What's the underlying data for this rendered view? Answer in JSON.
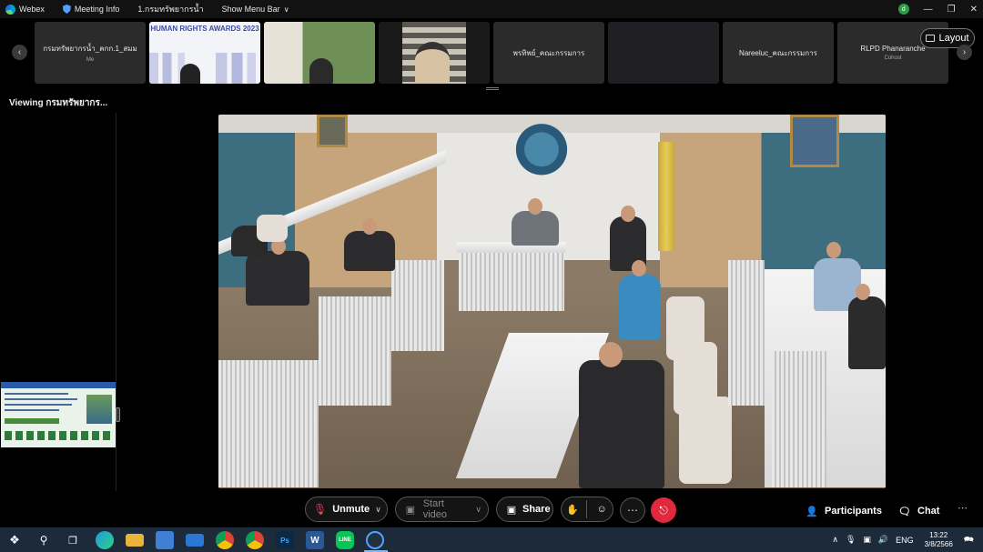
{
  "window": {
    "app_name": "Webex",
    "meeting_info_label": "Meeting Info",
    "meeting_name": "1.กรมทรัพยากรน้ำ",
    "menu_bar_label": "Show Menu Bar",
    "user_avatar_initial": "d"
  },
  "filmstrip": {
    "layout_label": "Layout",
    "tiles": [
      {
        "name": "กรมทรัพยากรน้ำ_คกก.1_สมม",
        "sub": "Me"
      },
      {
        "name": "",
        "sub": "",
        "overlay_text": "HUMAN RIGHTS AWARDS 2023"
      },
      {
        "name": "",
        "sub": ""
      },
      {
        "name": "",
        "sub": ""
      },
      {
        "name": "พรทิพย์_คณะกรรมการ",
        "sub": ""
      },
      {
        "name": "",
        "sub": ""
      },
      {
        "name": "Nareeluc_คณะกรรมการ",
        "sub": ""
      },
      {
        "name": "RLPD Phanaranche",
        "sub": "Cohost"
      }
    ]
  },
  "viewing": {
    "label": "Viewing กรมทรัพยากร..."
  },
  "controls": {
    "unmute_label": "Unmute",
    "start_video_label": "Start video",
    "share_label": "Share",
    "participants_label": "Participants",
    "chat_label": "Chat"
  },
  "taskbar": {
    "language": "ENG",
    "time": "13:22",
    "date": "3/8/2566",
    "apps": [
      "start",
      "search",
      "task-view",
      "edge",
      "file-explorer",
      "store",
      "mail",
      "chrome",
      "chrome-alt",
      "photoshop",
      "word",
      "line",
      "webex"
    ]
  },
  "colors": {
    "background": "#000000",
    "tile": "#2b2b2b",
    "leave_red": "#e0283e",
    "mute_red": "#e24a5b",
    "taskbar": "#1c2a3a"
  }
}
